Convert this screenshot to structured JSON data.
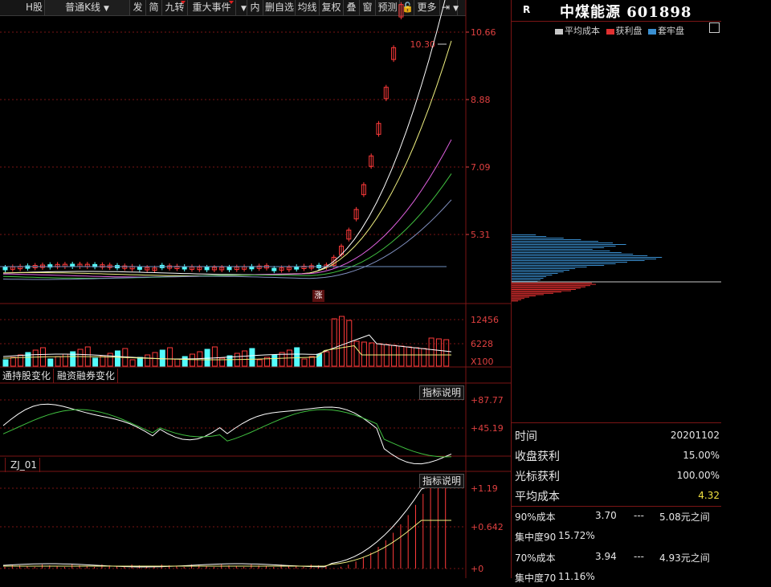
{
  "toolbar": {
    "items": [
      {
        "label": "H股",
        "dropdown": false,
        "dot": false
      },
      {
        "label": "普通K线",
        "dropdown": true,
        "dot": false
      },
      {
        "label": "发",
        "dropdown": false,
        "dot": false
      },
      {
        "label": "简",
        "dropdown": false,
        "dot": false
      },
      {
        "label": "九转",
        "dropdown": false,
        "dot": true
      },
      {
        "label": "重大事件",
        "dropdown": false,
        "dot": true
      },
      {
        "label": "",
        "dropdown": true,
        "dot": false
      },
      {
        "label": "内",
        "dropdown": false,
        "dot": false
      },
      {
        "label": "删自选",
        "dropdown": false,
        "dot": false
      },
      {
        "label": "均线",
        "dropdown": false,
        "dot": false
      },
      {
        "label": "复权",
        "dropdown": false,
        "dot": false
      },
      {
        "label": "叠",
        "dropdown": false,
        "dot": false
      },
      {
        "label": "窗",
        "dropdown": false,
        "dot": false
      },
      {
        "label": "预测",
        "dropdown": false,
        "dot": false
      },
      {
        "label": "🔓",
        "dropdown": false,
        "dot": false
      },
      {
        "label": "更多",
        "dropdown": false,
        "dot": false
      },
      {
        "label": "⇥",
        "dropdown": true,
        "dot": false
      }
    ]
  },
  "stock": {
    "badge": "R",
    "title": "中煤能源 601898"
  },
  "legend": {
    "items": [
      {
        "label": "平均成本",
        "color": "#c8c8c8"
      },
      {
        "label": "获利盘",
        "color": "#e03030"
      },
      {
        "label": "套牢盘",
        "color": "#3a8fd0"
      }
    ]
  },
  "price_chart": {
    "axis_labels": [
      "10.66",
      "8.88",
      "7.09",
      "5.31"
    ],
    "high_label": "10.30",
    "badge": "涨"
  },
  "volume_chart": {
    "axis_labels": [
      "12456",
      "6228"
    ],
    "unit": "X100"
  },
  "tabs": [
    "通持股变化",
    "融资融券变化"
  ],
  "indicator1": {
    "explain": "指标说明",
    "axis_labels": [
      "+87.77",
      "+45.19"
    ]
  },
  "indicator2": {
    "tab_left": "",
    "tab_name": "ZJ_01",
    "explain": "指标说明",
    "axis_labels": [
      "+1.19",
      "+0.642",
      "+0"
    ]
  },
  "info": {
    "rows": [
      {
        "label": "时间",
        "value": "20201102",
        "color": "#e6e6e6"
      },
      {
        "label": "收盘获利",
        "value": "15.00%",
        "color": "#e6e6e6"
      },
      {
        "label": "光标获利",
        "value": "100.00%",
        "color": "#e6e6e6"
      },
      {
        "label": "平均成本",
        "value": "4.32",
        "color": "#f0e040"
      }
    ],
    "cost_rows": [
      {
        "label": "90%成本",
        "low": "3.70",
        "dash": "---",
        "high": "5.08元之间"
      },
      {
        "label": "集中度90",
        "low": "15.72%",
        "dash": "",
        "high": ""
      },
      {
        "label": "70%成本",
        "low": "3.94",
        "dash": "---",
        "high": "4.93元之间"
      },
      {
        "label": "集中度70",
        "low": "11.16%",
        "dash": "",
        "high": ""
      }
    ]
  },
  "colors": {
    "up": "#ff3a3a",
    "down": "#54fcfc",
    "grid": "#7a1515",
    "ma": [
      "#ffffff",
      "#f0f080",
      "#e060e0",
      "#40c040",
      "#8090c0"
    ]
  }
}
